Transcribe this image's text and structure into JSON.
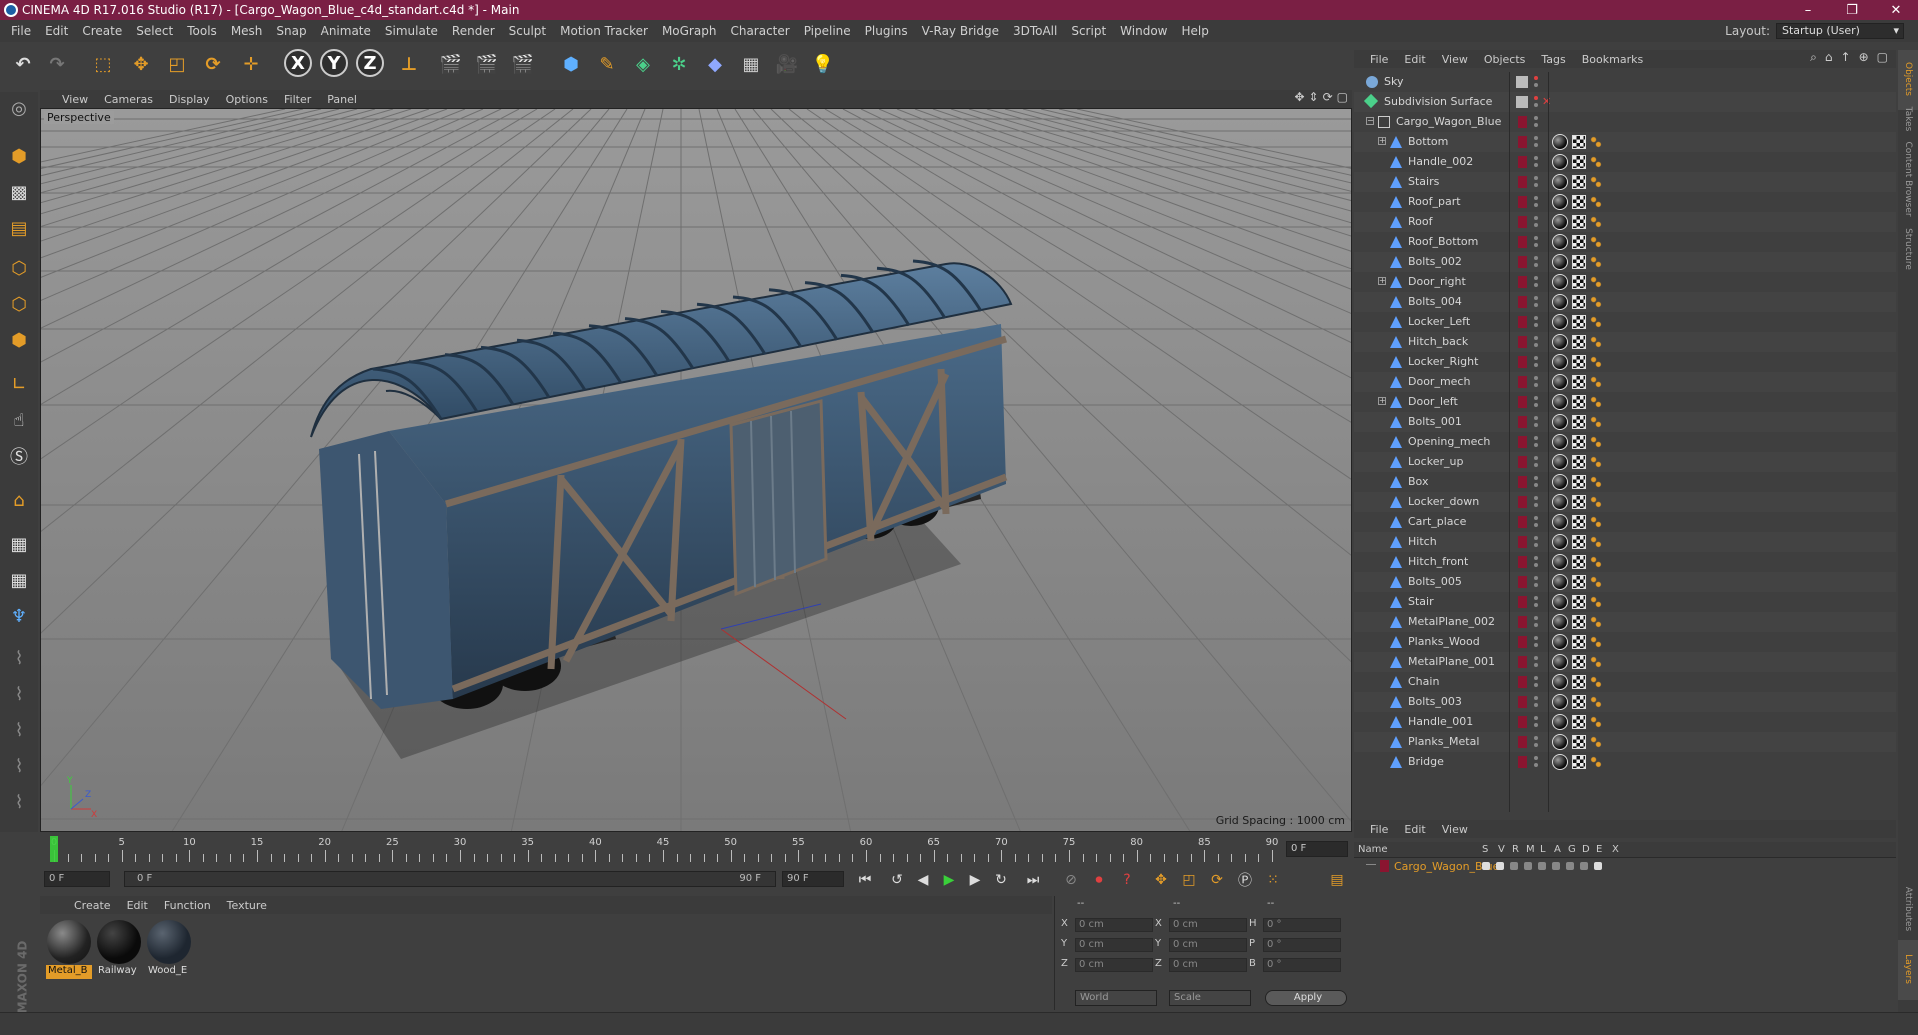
{
  "window": {
    "title": "CINEMA 4D R17.016 Studio (R17) - [Cargo_Wagon_Blue_c4d_standart.c4d *] - Main",
    "controls": [
      "–",
      "❐",
      "✕"
    ]
  },
  "menu": [
    "File",
    "Edit",
    "Create",
    "Select",
    "Tools",
    "Mesh",
    "Snap",
    "Animate",
    "Simulate",
    "Render",
    "Sculpt",
    "Motion Tracker",
    "MoGraph",
    "Character",
    "Pipeline",
    "Plugins",
    "V-Ray Bridge",
    "3DToAll",
    "Script",
    "Window",
    "Help"
  ],
  "layout": {
    "label": "Layout:",
    "value": "Startup (User)"
  },
  "toolbar": {
    "axis_x": "X",
    "axis_y": "Y",
    "axis_z": "Z"
  },
  "viewport": {
    "menu": [
      "View",
      "Cameras",
      "Display",
      "Options",
      "Filter",
      "Panel"
    ],
    "label": "Perspective",
    "grid_spacing": "Grid Spacing : 1000 cm"
  },
  "timeline": {
    "ticks": [
      "0",
      "5",
      "10",
      "15",
      "20",
      "25",
      "30",
      "35",
      "40",
      "45",
      "50",
      "55",
      "60",
      "65",
      "70",
      "75",
      "80",
      "85",
      "90"
    ],
    "frame_end": "0 F"
  },
  "transport": {
    "start": "0 F",
    "slider_start": "0 F",
    "slider_end": "90 F",
    "end": "90 F"
  },
  "materials": {
    "menu": [
      "Create",
      "Edit",
      "Function",
      "Texture"
    ],
    "items": [
      {
        "name": "Metal_B",
        "selected": true
      },
      {
        "name": "Railway",
        "selected": false
      },
      {
        "name": "Wood_E",
        "selected": false
      }
    ]
  },
  "coordinates": {
    "headers": [
      "--",
      "--",
      "--"
    ],
    "rows": [
      {
        "a": "X",
        "av": "0 cm",
        "b": "X",
        "bv": "0 cm",
        "c": "H",
        "cv": "0 °"
      },
      {
        "a": "Y",
        "av": "0 cm",
        "b": "Y",
        "bv": "0 cm",
        "c": "P",
        "cv": "0 °"
      },
      {
        "a": "Z",
        "av": "0 cm",
        "b": "Z",
        "bv": "0 cm",
        "c": "B",
        "cv": "0 °"
      }
    ],
    "mode1": "World",
    "mode2": "Scale",
    "apply": "Apply"
  },
  "object_manager": {
    "menu": [
      "File",
      "Edit",
      "View",
      "Objects",
      "Tags",
      "Bookmarks"
    ],
    "objects": [
      {
        "name": "Sky",
        "level": 0,
        "type": "sky"
      },
      {
        "name": "Subdivision Surface",
        "level": 0,
        "type": "subdiv"
      },
      {
        "name": "Cargo_Wagon_Blue",
        "level": 1,
        "type": "null"
      },
      {
        "name": "Bottom",
        "level": 2,
        "type": "poly"
      },
      {
        "name": "Handle_002",
        "level": 2,
        "type": "poly"
      },
      {
        "name": "Stairs",
        "level": 2,
        "type": "poly"
      },
      {
        "name": "Roof_part",
        "level": 2,
        "type": "poly"
      },
      {
        "name": "Roof",
        "level": 2,
        "type": "poly"
      },
      {
        "name": "Roof_Bottom",
        "level": 2,
        "type": "poly"
      },
      {
        "name": "Bolts_002",
        "level": 2,
        "type": "poly"
      },
      {
        "name": "Door_right",
        "level": 2,
        "type": "poly"
      },
      {
        "name": "Bolts_004",
        "level": 2,
        "type": "poly"
      },
      {
        "name": "Locker_Left",
        "level": 2,
        "type": "poly"
      },
      {
        "name": "Hitch_back",
        "level": 2,
        "type": "poly"
      },
      {
        "name": "Locker_Right",
        "level": 2,
        "type": "poly"
      },
      {
        "name": "Door_mech",
        "level": 2,
        "type": "poly"
      },
      {
        "name": "Door_left",
        "level": 2,
        "type": "poly"
      },
      {
        "name": "Bolts_001",
        "level": 2,
        "type": "poly"
      },
      {
        "name": "Opening_mech",
        "level": 2,
        "type": "poly"
      },
      {
        "name": "Locker_up",
        "level": 2,
        "type": "poly"
      },
      {
        "name": "Box",
        "level": 2,
        "type": "poly"
      },
      {
        "name": "Locker_down",
        "level": 2,
        "type": "poly"
      },
      {
        "name": "Cart_place",
        "level": 2,
        "type": "poly"
      },
      {
        "name": "Hitch",
        "level": 2,
        "type": "poly"
      },
      {
        "name": "Hitch_front",
        "level": 2,
        "type": "poly"
      },
      {
        "name": "Bolts_005",
        "level": 2,
        "type": "poly"
      },
      {
        "name": "Stair",
        "level": 2,
        "type": "poly"
      },
      {
        "name": "MetalPlane_002",
        "level": 2,
        "type": "poly"
      },
      {
        "name": "Planks_Wood",
        "level": 2,
        "type": "poly"
      },
      {
        "name": "MetalPlane_001",
        "level": 2,
        "type": "poly"
      },
      {
        "name": "Chain",
        "level": 2,
        "type": "poly"
      },
      {
        "name": "Bolts_003",
        "level": 2,
        "type": "poly"
      },
      {
        "name": "Handle_001",
        "level": 2,
        "type": "poly"
      },
      {
        "name": "Planks_Metal",
        "level": 2,
        "type": "poly"
      },
      {
        "name": "Bridge",
        "level": 2,
        "type": "poly"
      }
    ]
  },
  "layer_manager": {
    "menu": [
      "File",
      "Edit",
      "View"
    ],
    "columns": [
      "Name",
      "S",
      "V",
      "R",
      "M",
      "L",
      "A",
      "G",
      "D",
      "E",
      "X"
    ],
    "row": "Cargo_Wagon_Blue"
  },
  "side_tabs": [
    "Objects",
    "Takes",
    "Content Browser",
    "Structure",
    "Attributes",
    "Layers"
  ],
  "colors": {
    "title_bar": "#7a1f44",
    "accent": "#e39c28",
    "layer_color": "#8a1530"
  }
}
